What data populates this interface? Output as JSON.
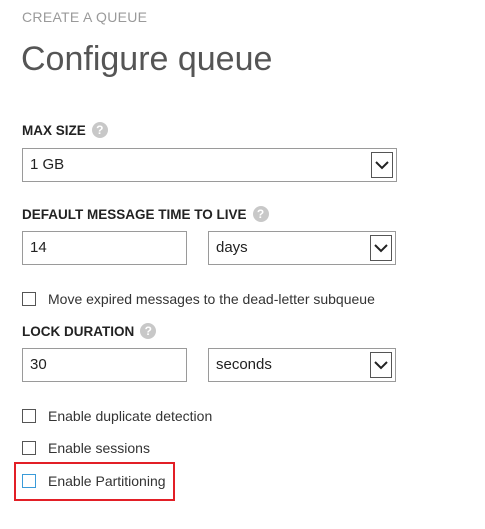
{
  "header": {
    "step": "CREATE A QUEUE",
    "title": "Configure queue"
  },
  "max_size": {
    "label": "MAX SIZE",
    "value": "1 GB",
    "help_icon": "question-icon"
  },
  "ttl": {
    "label": "DEFAULT MESSAGE TIME TO LIVE",
    "value": "14",
    "unit": "days",
    "help_icon": "question-icon"
  },
  "dead_letter": {
    "label": "Move expired messages to the dead-letter subqueue",
    "checked": false
  },
  "lock": {
    "label": "LOCK DURATION",
    "value": "30",
    "unit": "seconds",
    "help_icon": "question-icon"
  },
  "options": [
    {
      "label": "Enable duplicate detection",
      "checked": false
    },
    {
      "label": "Enable sessions",
      "checked": false
    },
    {
      "label": "Enable Partitioning",
      "checked": false
    }
  ],
  "colors": {
    "highlight": "#e21f26",
    "accent": "#3a9bd9"
  }
}
